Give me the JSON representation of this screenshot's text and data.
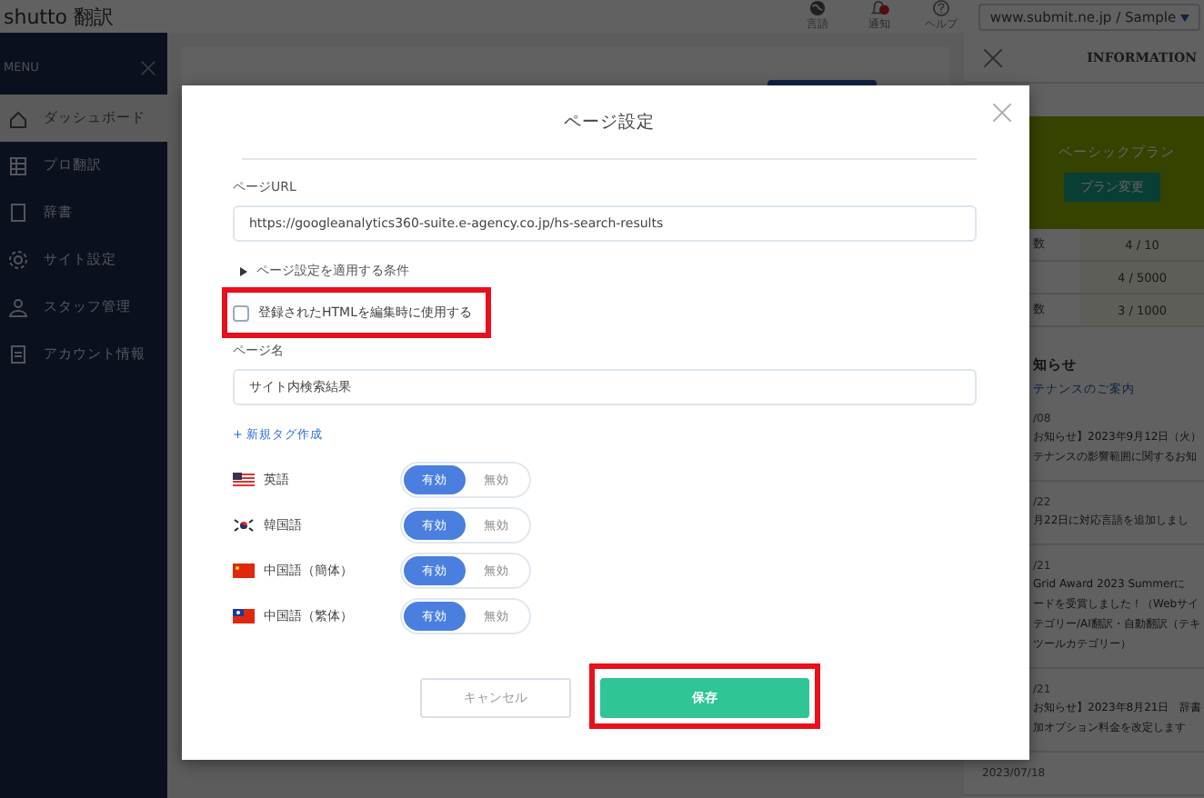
{
  "header": {
    "logo": "shutto 翻訳",
    "tools": [
      {
        "kind": "globe",
        "label": "言語"
      },
      {
        "kind": "bell",
        "label": "通知"
      },
      {
        "kind": "help",
        "label": "ヘルプ"
      }
    ],
    "site_selector": "www.submit.ne.jp / Sample"
  },
  "sidebar": {
    "title": "MENU",
    "items": [
      {
        "label": "ダッシュボード",
        "selected": true
      },
      {
        "label": "プロ翻訳",
        "selected": false
      },
      {
        "label": "辞書",
        "selected": false
      },
      {
        "label": "サイト設定",
        "selected": false
      },
      {
        "label": "スタッフ管理",
        "selected": false
      },
      {
        "label": "アカウント情報",
        "selected": false
      }
    ]
  },
  "info": {
    "title": "INFORMATION",
    "plan": {
      "name": "ベーシックプラン",
      "button": "プラン変更"
    },
    "usage": [
      {
        "label": "数",
        "value": "4 / 10"
      },
      {
        "value": "4 / 5000"
      },
      {
        "label": "数",
        "value": "3 / 1000"
      }
    ],
    "news_heading": "知らせ",
    "news_link": "テナンスのご案内",
    "news": [
      {
        "date": "/08",
        "lines": [
          "お知らせ】2023年9月12日（火）",
          "テナンスの影響範囲に関するお知"
        ]
      },
      {
        "date": "/22",
        "lines": [
          "月22日に対応言語を追加しまし"
        ]
      },
      {
        "date": "/21",
        "lines": [
          "Grid Award 2023 Summerに",
          "ードを受賞しました！（Webサイ",
          "テゴリー/AI翻訳・自動翻訳（テキ",
          "ツールカテゴリー）"
        ]
      },
      {
        "date": "/21",
        "lines": [
          "お知らせ】2023年8月21日　辞書",
          "加オプション料金を改定します"
        ]
      },
      {
        "date": "2023/07/18"
      }
    ]
  },
  "modal": {
    "title": "ページ設定",
    "url_label": "ページURL",
    "url_value": "https://googleanalytics360-suite.e-agency.co.jp/hs-search-results",
    "conditions_label": "ページ設定を適用する条件",
    "use_html": {
      "label": "登録されたHTMLを編集時に使用する",
      "checked": false,
      "highlighted": true
    },
    "name_label": "ページ名",
    "name_value": "サイト内検索結果",
    "new_tag_link": "+ 新規タグ作成",
    "languages": [
      {
        "name": "英語",
        "toggle": [
          {
            "label": "有効",
            "selected": true
          },
          {
            "label": "無効",
            "selected": false
          }
        ]
      },
      {
        "name": "韓国語",
        "toggle": [
          {
            "label": "有効",
            "selected": true
          },
          {
            "label": "無効",
            "selected": false
          }
        ]
      },
      {
        "name": "中国語（簡体）",
        "toggle": [
          {
            "label": "有効",
            "selected": true
          },
          {
            "label": "無効",
            "selected": false
          }
        ]
      },
      {
        "name": "中国語（繁体）",
        "toggle": [
          {
            "label": "有効",
            "selected": true
          },
          {
            "label": "無効",
            "selected": false
          }
        ]
      }
    ],
    "buttons": [
      {
        "kind": "secondary",
        "label": "キャンセル",
        "highlighted": false
      },
      {
        "kind": "primary",
        "label": "保存",
        "highlighted": true
      }
    ]
  }
}
